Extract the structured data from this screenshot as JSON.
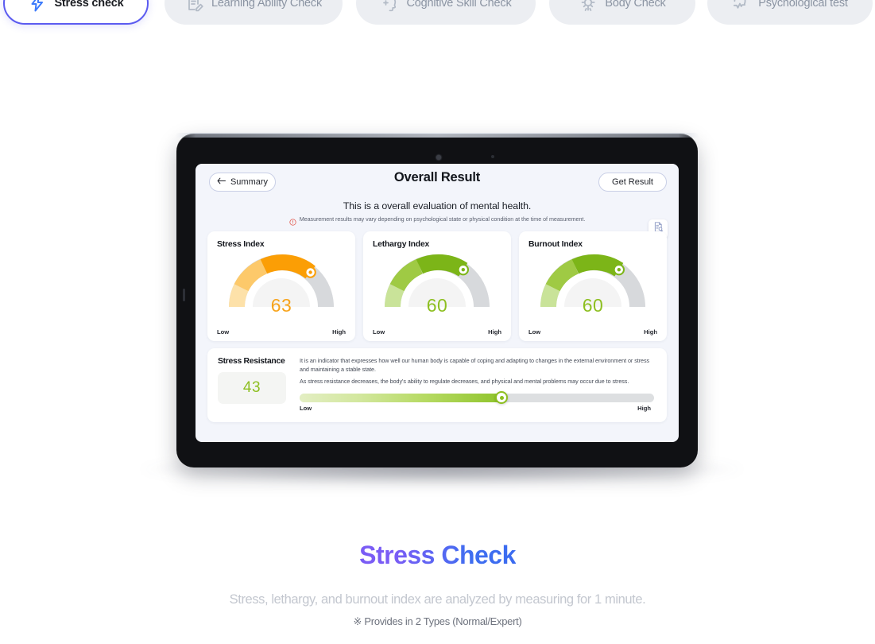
{
  "tabs": [
    {
      "label": "Stress check",
      "icon": "bolt-icon",
      "active": true
    },
    {
      "label": "Learning Ability Check",
      "icon": "notepad-pencil-icon",
      "active": false
    },
    {
      "label": "Cognitive Skill Check",
      "icon": "head-plus-icon",
      "active": false
    },
    {
      "label": "Body Check",
      "icon": "gear-sun-icon",
      "active": false
    },
    {
      "label": "Psychological test",
      "icon": "heart-pulse-icon",
      "active": false
    }
  ],
  "device": {
    "type": "tablet",
    "camera_dots": 2
  },
  "screen": {
    "back_button": "Summary",
    "back_icon": "arrow-left-icon",
    "title": "Overall Result",
    "action_button": "Get Result",
    "subtitle": "This is a overall evaluation of mental health.",
    "notice_icon": "warning-circle-icon",
    "notice": "Measurement results may vary depending on psychological state or physical condition at the time of measurement.",
    "report_icon": "document-search-icon",
    "scale_low": "Low",
    "scale_high": "High"
  },
  "chart_data": [
    {
      "type": "gauge",
      "title": "Stress Index",
      "value": 63,
      "min": 0,
      "max": 100,
      "xlabel": "Low",
      "ylabel": "High",
      "value_color": "#f7a31b",
      "track_color": "#d7d9dc",
      "segments": [
        {
          "from": 0,
          "to": 20,
          "color": "#fde1a9"
        },
        {
          "from": 20,
          "to": 42,
          "color": "#fdc96a"
        },
        {
          "from": 42,
          "to": 63,
          "color": "#fb9e05"
        }
      ]
    },
    {
      "type": "gauge",
      "title": "Lethargy Index",
      "value": 60,
      "min": 0,
      "max": 100,
      "xlabel": "Low",
      "ylabel": "High",
      "value_color": "#8dbf20",
      "track_color": "#d7d9dc",
      "segments": [
        {
          "from": 0,
          "to": 20,
          "color": "#c9e399"
        },
        {
          "from": 20,
          "to": 42,
          "color": "#9fca44"
        },
        {
          "from": 42,
          "to": 60,
          "color": "#7cb518"
        }
      ]
    },
    {
      "type": "gauge",
      "title": "Burnout Index",
      "value": 60,
      "min": 0,
      "max": 100,
      "xlabel": "Low",
      "ylabel": "High",
      "value_color": "#8dbf20",
      "track_color": "#d7d9dc",
      "segments": [
        {
          "from": 0,
          "to": 20,
          "color": "#c9e399"
        },
        {
          "from": 20,
          "to": 42,
          "color": "#9fca44"
        },
        {
          "from": 42,
          "to": 60,
          "color": "#7cb518"
        }
      ]
    },
    {
      "type": "bar",
      "title": "Stress Resistance",
      "value": 43,
      "min": 0,
      "max": 75,
      "percent": 57,
      "xlabel": "Low",
      "ylabel": "High",
      "value_color": "#8dbf20"
    }
  ],
  "resistance": {
    "title": "Stress Resistance",
    "value": "43",
    "desc_line1": "It is an indicator that expresses how well our human body is capable of coping and adapting to changes in the external environment or stress and maintaining a stable state.",
    "desc_line2": "As stress resistance decreases, the body's ability to regulate decreases, and physical and mental problems may occur due to stress.",
    "label_low": "Low",
    "label_high": "High"
  },
  "caption": {
    "title": "Stress Check",
    "subtitle": "Stress, lethargy, and burnout index are analyzed by measuring for 1 minute.",
    "note": "※ Provides in 2 Types (Normal/Expert)"
  }
}
